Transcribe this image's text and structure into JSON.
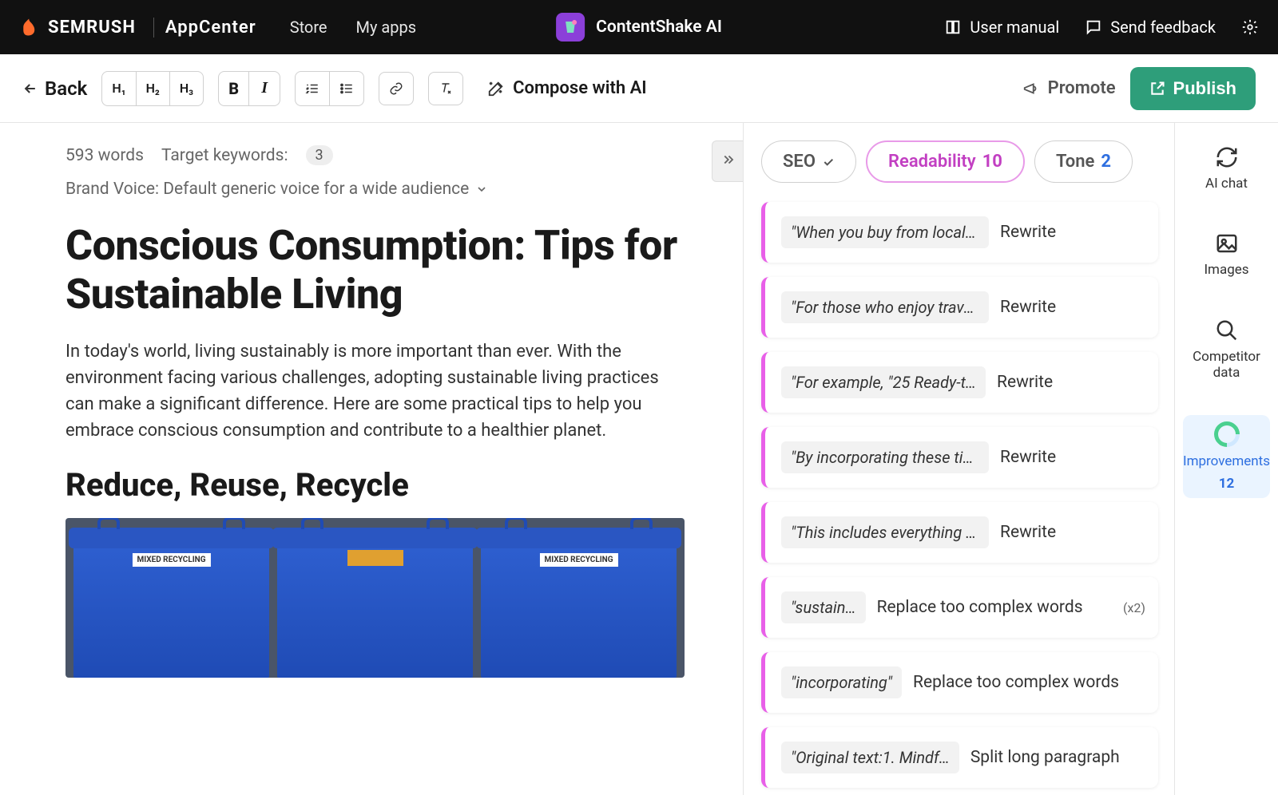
{
  "topbar": {
    "brand": "SEMRUSH",
    "appcenter": "AppCenter",
    "nav": {
      "store": "Store",
      "myapps": "My apps"
    },
    "app_name": "ContentShake AI",
    "user_manual": "User manual",
    "send_feedback": "Send feedback"
  },
  "toolbar": {
    "back": "Back",
    "h1": "H₁",
    "h2": "H₂",
    "h3": "H₃",
    "bold": "B",
    "italic": "I",
    "compose": "Compose with AI",
    "promote": "Promote",
    "publish": "Publish"
  },
  "editor": {
    "word_count": "593 words",
    "target_label": "Target keywords:",
    "target_count": "3",
    "brand_voice": "Brand Voice: Default generic voice for a wide audience",
    "title": "Conscious Consumption: Tips for Sustainable Living",
    "intro": "In today's world, living sustainably is more important than ever. With the environment facing various challenges, adopting sustainable living practices can make a significant difference. Here are some practical tips to help you embrace conscious consumption and contribute to a healthier planet.",
    "h2": "Reduce, Reuse, Recycle",
    "bin_label": "MIXED RECYCLING"
  },
  "pills": {
    "seo_label": "SEO",
    "read_label": "Readability",
    "read_num": "10",
    "tone_label": "Tone",
    "tone_num": "2"
  },
  "suggestions": [
    {
      "quote": "\"When you buy from local f…",
      "action": "Rewrite",
      "cls": ""
    },
    {
      "quote": "\"For those who enjoy travel…",
      "action": "Rewrite",
      "cls": ""
    },
    {
      "quote": "\"For example, \"25 Ready-t…",
      "action": "Rewrite",
      "cls": ""
    },
    {
      "quote": "\"By incorporating these tip…",
      "action": "Rewrite",
      "cls": ""
    },
    {
      "quote": "\"This includes everything fr…",
      "action": "Rewrite",
      "cls": ""
    },
    {
      "quote": "\"sustain…",
      "action": "Replace too complex words",
      "count": "(x2)",
      "cls": "narrow"
    },
    {
      "quote": "\"incorporating\"",
      "action": "Replace too complex words",
      "cls": "mid"
    },
    {
      "quote": "\"Original text:1. Mindf…",
      "action": "Split long paragraph",
      "cls": "mid2"
    }
  ],
  "rail": {
    "ai_chat": "AI chat",
    "images": "Images",
    "competitor": "Competitor data",
    "improvements": "Improvements",
    "improvements_num": "12"
  }
}
